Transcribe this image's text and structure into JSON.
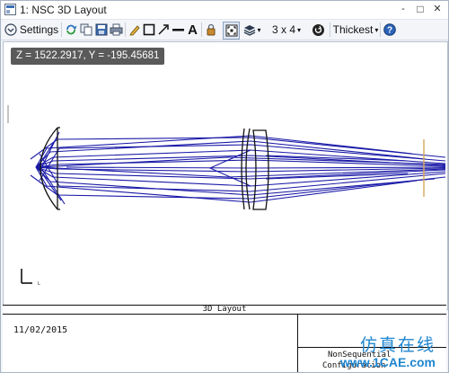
{
  "window": {
    "title": "1: NSC 3D Layout",
    "controls": {
      "minimize": "-",
      "maximize": "□",
      "close": "✕"
    }
  },
  "toolbar": {
    "settings_label": "Settings",
    "grid_label": "3 x 4",
    "thickness_label": "Thickest",
    "icons": [
      "chevron-down-icon",
      "refresh-icon",
      "copy-icon",
      "save-icon",
      "print-icon",
      "pencil-icon",
      "rectangle-icon",
      "arrow-icon",
      "line-icon",
      "text-icon",
      "lock-icon",
      "fit-view-icon",
      "layers-icon",
      "layout-grid-icon",
      "rotate-icon",
      "help-icon"
    ]
  },
  "canvas": {
    "coord_readout": "Z = 1522.2917, Y = -195.45681",
    "axis_marker": "L"
  },
  "info_block": {
    "title": "3D Layout",
    "date": "11/02/2015",
    "line1": "NonSequential",
    "line2": "Configuration"
  },
  "watermark": {
    "chinese": "仿真在线",
    "url": "www.1CAE.com"
  },
  "colors": {
    "ray": "#1a1aa8",
    "lens": "#111111",
    "detector": "#d8a85a",
    "watermark": "#1f86d0"
  }
}
